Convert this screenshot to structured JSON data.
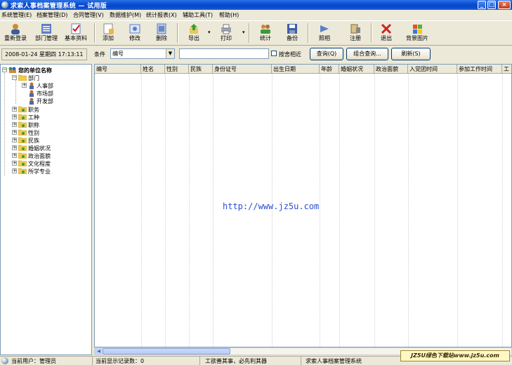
{
  "window": {
    "title": "求索人事档案管理系统  —  试用版"
  },
  "menu": [
    "系统管理(E)",
    "档案管理(D)",
    "合同管理(V)",
    "数据维护(M)",
    "统计报表(X)",
    "辅助工具(T)",
    "帮助(H)"
  ],
  "toolbar": {
    "relogin": "重新登录",
    "dept": "部门管理",
    "basic": "基本资料",
    "add": "添加",
    "edit": "修改",
    "delete": "删除",
    "export": "导出",
    "print": "打印",
    "stats": "统计",
    "backup": "备份",
    "photo": "照相",
    "register": "注册",
    "exit": "退出",
    "bgimage": "背景图片"
  },
  "search": {
    "datetime": "2008-01-24 星期四 17:13:11",
    "condition_label": "条件",
    "condition_value": "编号",
    "keyword": "",
    "fuzzy_label": "按舍相近",
    "query_btn": "查询(Q)",
    "combo_query_btn": "组合查询...",
    "refresh_btn": "刷新(S)"
  },
  "tree": {
    "root": "您的单位名称",
    "dept": "部门",
    "dept_children": [
      "人事部",
      "市场部",
      "开发部"
    ],
    "categories": [
      "职务",
      "工种",
      "职称",
      "性别",
      "民族",
      "婚姻状况",
      "政治面貌",
      "文化程度",
      "所学专业"
    ]
  },
  "grid": {
    "columns": [
      "编号",
      "姓名",
      "性别",
      "民族",
      "身份证号",
      "出生日期",
      "年龄",
      "婚姻状况",
      "政治面貌",
      "入党团时间",
      "参加工作时间",
      "工"
    ],
    "watermark": "http://www.jz5u.com"
  },
  "status": {
    "user": "当前用户：管理员",
    "records": "当前显示记录数：0",
    "motto": "工欲善其事，必先利其器",
    "appname": "求索人事档案管理系统",
    "logo": "JZ5U绿色下载站www.jz5u.com"
  },
  "colors": {
    "titlebar": "#0A4FD4",
    "face": "#ECE9D8",
    "link": "#2B4FD1"
  }
}
